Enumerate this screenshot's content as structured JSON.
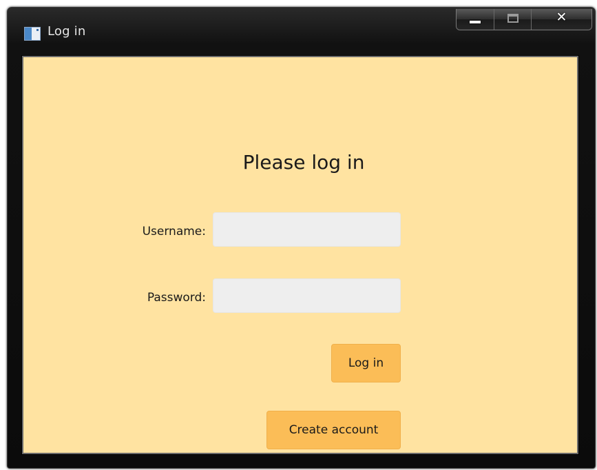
{
  "window": {
    "title": "Log in",
    "controls": {
      "minimize": "minimize-icon",
      "maximize": "maximize-icon",
      "close_icon": "close-icon",
      "close_glyph": "✕"
    }
  },
  "form": {
    "heading": "Please log in",
    "username": {
      "label": "Username:",
      "value": "",
      "placeholder": ""
    },
    "password": {
      "label": "Password:",
      "value": "",
      "placeholder": ""
    },
    "login_button": "Log in",
    "create_account_button": "Create account"
  },
  "colors": {
    "background": "#ffe3a1",
    "button": "#fbbd57",
    "input": "#eeeeee",
    "title_bar": "#111111"
  }
}
